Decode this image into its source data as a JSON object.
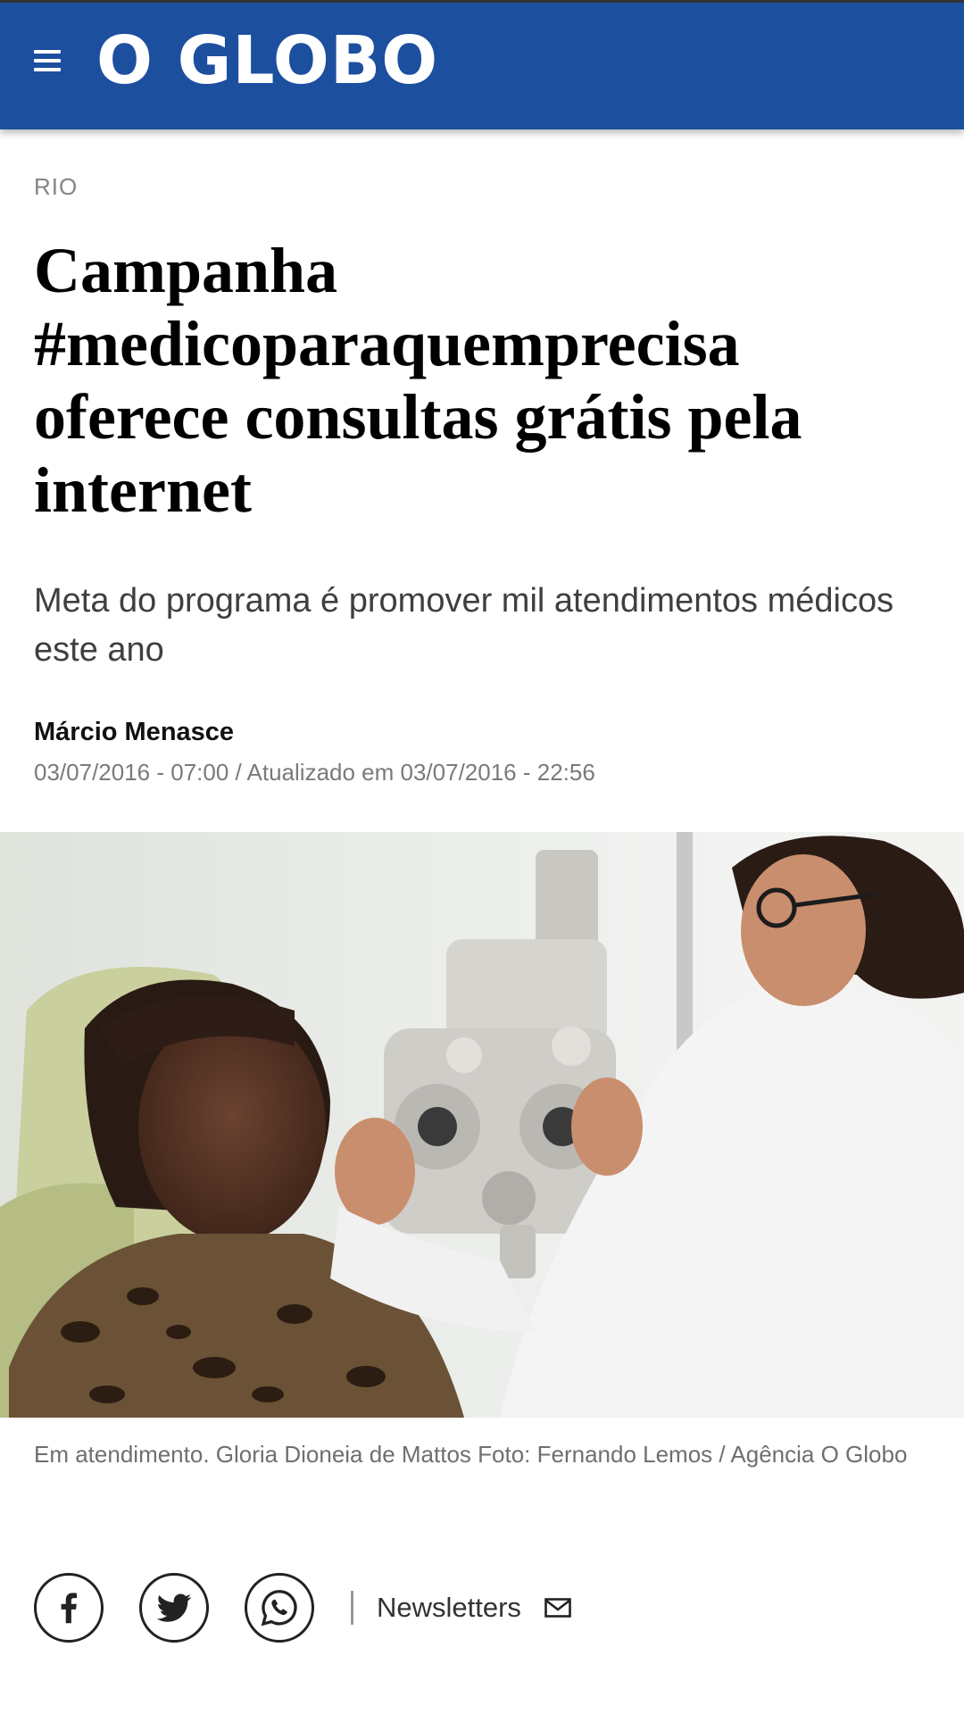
{
  "header": {
    "logo_text": "O GLOBO",
    "brand_color": "#1d4f9f",
    "menu_icon": "hamburger-menu-icon"
  },
  "article": {
    "section": "RIO",
    "headline": "Campanha #medicoparaquemprecisa oferece consultas grátis pela internet",
    "subtitle": "Meta do programa é promover mil atendimentos médicos este ano",
    "author": "Márcio Menasce",
    "dates": "03/07/2016 - 07:00 / Atualizado em 03/07/2016 - 22:56",
    "photo_caption": "Em atendimento. Gloria Dioneia de Mattos Foto: Fernando Lemos / Agência O Globo"
  },
  "share": {
    "icons": [
      "facebook-icon",
      "twitter-icon",
      "whatsapp-icon"
    ],
    "newsletters_label": "Newsletters",
    "newsletters_icon": "mail-icon"
  }
}
